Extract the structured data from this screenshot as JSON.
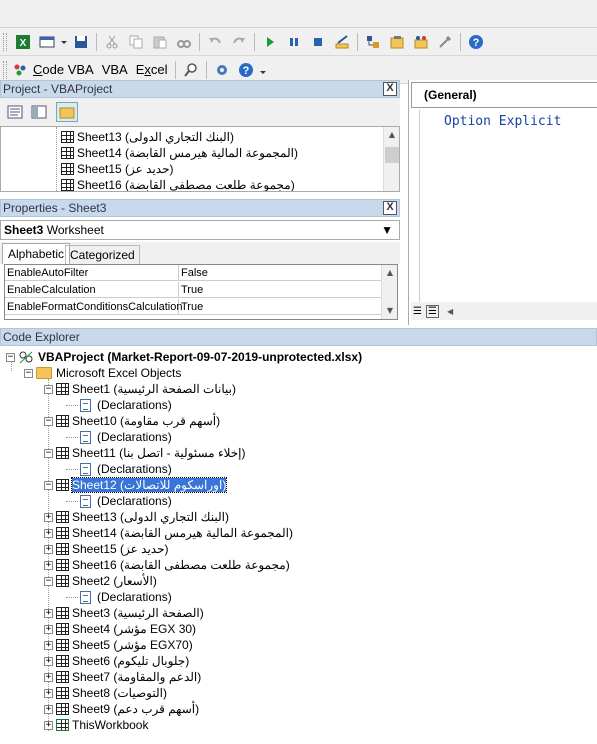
{
  "toolbar2": {
    "code_vba": "Code VBA",
    "vba": "VBA",
    "excel": "Excel"
  },
  "project_panel": {
    "title": "Project - VBAProject",
    "close": "X",
    "items": [
      "Sheet13 (البنك التجاري الدولى)",
      "Sheet14 (المجموعة المالية هيرمس القابضة)",
      "Sheet15 (حديد عز)",
      "Sheet16 (مجموعة طلعت مصطفى القابضة)"
    ]
  },
  "properties_panel": {
    "title": "Properties - Sheet3",
    "close": "X",
    "object_name": "Sheet3",
    "object_type": "Worksheet",
    "tabs": [
      "Alphabetic",
      "Categorized"
    ],
    "rows": [
      {
        "name": "EnableAutoFilter",
        "value": "False"
      },
      {
        "name": "EnableCalculation",
        "value": "True"
      },
      {
        "name": "EnableFormatConditionsCalculation",
        "value": "True"
      }
    ]
  },
  "code_window": {
    "object_dropdown": "(General)",
    "code_line": "Option Explicit"
  },
  "code_explorer": {
    "title": "Code Explorer",
    "project": "VBAProject (Market-Report-09-07-2019-unprotected.xlsx)",
    "folder": "Microsoft Excel Objects",
    "declarations": "(Declarations)",
    "sheets": [
      {
        "label": "Sheet1 (بيانات الصفحة الرئيسية)",
        "expanded": true
      },
      {
        "label": "Sheet10 (أسهم قرب مقاومة)",
        "expanded": true
      },
      {
        "label": "Sheet11 (إخلاء مسئولية - اتصل بنا)",
        "expanded": true
      },
      {
        "label": "Sheet12 (اوراسكوم للاتصالات)",
        "expanded": true,
        "selected": true
      },
      {
        "label": "Sheet13 (البنك التجاري الدولى)",
        "expanded": false
      },
      {
        "label": "Sheet14 (المجموعة المالية هيرمس القابضة)",
        "expanded": false
      },
      {
        "label": "Sheet15 (حديد عز)",
        "expanded": false
      },
      {
        "label": "Sheet16 (مجموعة طلعت مصطفى القابضة)",
        "expanded": false
      },
      {
        "label": "Sheet2 (الأسعار)",
        "expanded": true
      },
      {
        "label": "Sheet3 (الصفحة الرئيسية)",
        "expanded": false
      },
      {
        "label": "Sheet4 (مؤشر EGX 30)",
        "expanded": false
      },
      {
        "label": "Sheet5 (مؤشر EGX70)",
        "expanded": false
      },
      {
        "label": "Sheet6 (جلوبال تليكوم)",
        "expanded": false
      },
      {
        "label": "Sheet7 (الدعم والمقاومة)",
        "expanded": false
      },
      {
        "label": "Sheet8 (التوصيات)",
        "expanded": false
      },
      {
        "label": "Sheet9 (أسهم قرب دعم)",
        "expanded": false
      }
    ],
    "workbook": "ThisWorkbook"
  }
}
